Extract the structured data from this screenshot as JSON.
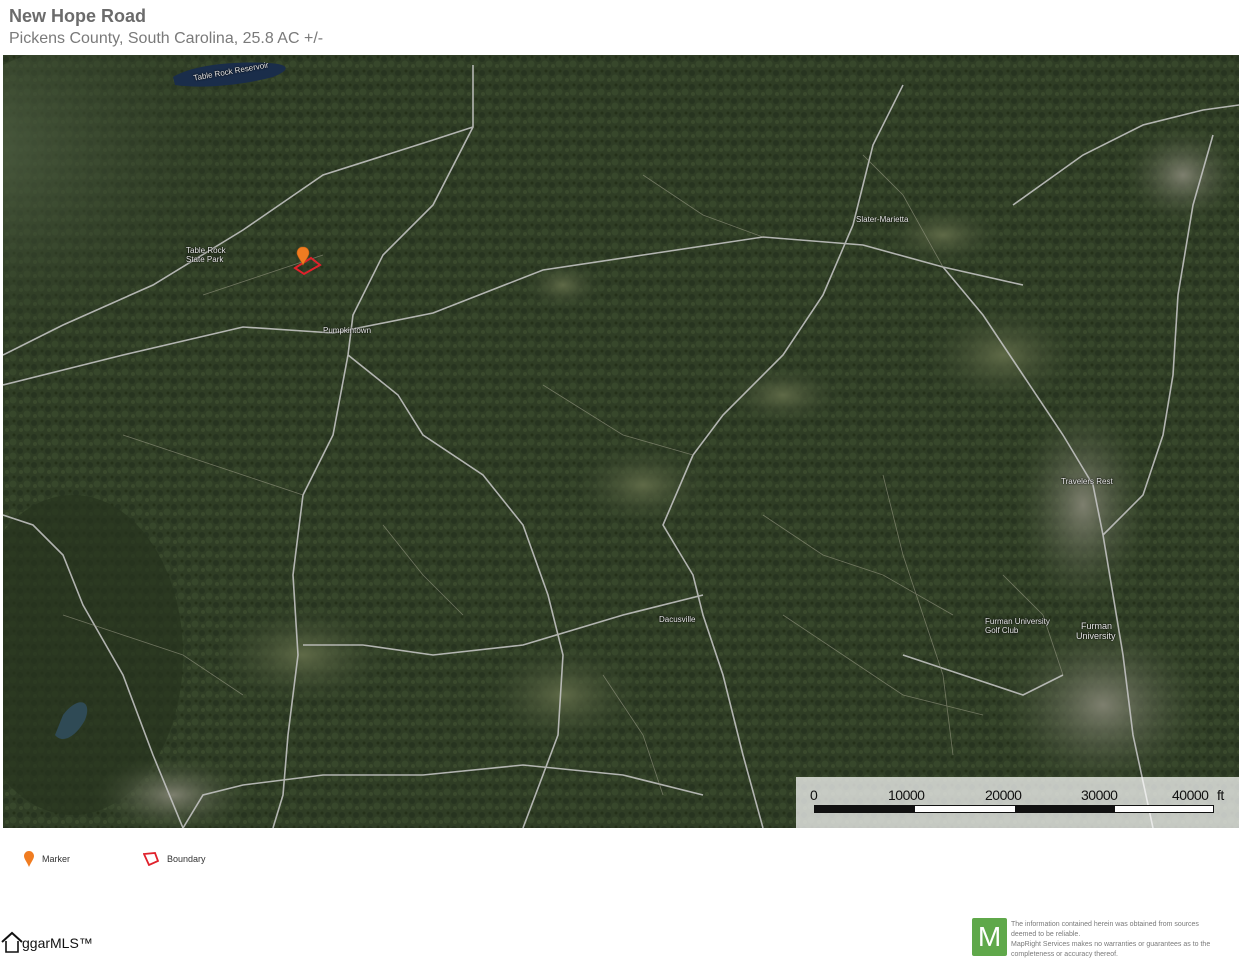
{
  "header": {
    "title": "New Hope Road",
    "subtitle": "Pickens County, South Carolina, 25.8 AC +/-"
  },
  "map": {
    "place_labels": {
      "table_rock_reservoir": "Table Rock Reservoir",
      "table_rock_state_park_1": "Table Rock",
      "table_rock_state_park_2": "State Park",
      "pumpkintown": "Pumpkintown",
      "slater_marietta": "Slater-Marietta",
      "travelers_rest": "Travelers Rest",
      "dacusville": "Dacusville",
      "furman_golf_club": "Furman University Golf Club",
      "furman_university_1": "Furman",
      "furman_university_2": "University"
    },
    "scale": {
      "ticks": [
        "0",
        "10000",
        "20000",
        "30000",
        "40000"
      ],
      "unit": "ft"
    },
    "colors": {
      "marker": "#f07c21",
      "boundary": "#e0212b",
      "roads": "#c9c9c9"
    }
  },
  "legend": {
    "marker_label": "Marker",
    "boundary_label": "Boundary",
    "marker_icon": "map-pin-icon",
    "boundary_icon": "polygon-boundary-icon"
  },
  "footer": {
    "mls_brand": "ggarMLS™",
    "mapright_letter": "M",
    "disclaimer_lines": [
      "The information contained herein was obtained from sources",
      "deemed to be reliable.",
      "MapRight Services makes no warranties or guarantees as to the",
      "completeness or accuracy thereof."
    ]
  }
}
